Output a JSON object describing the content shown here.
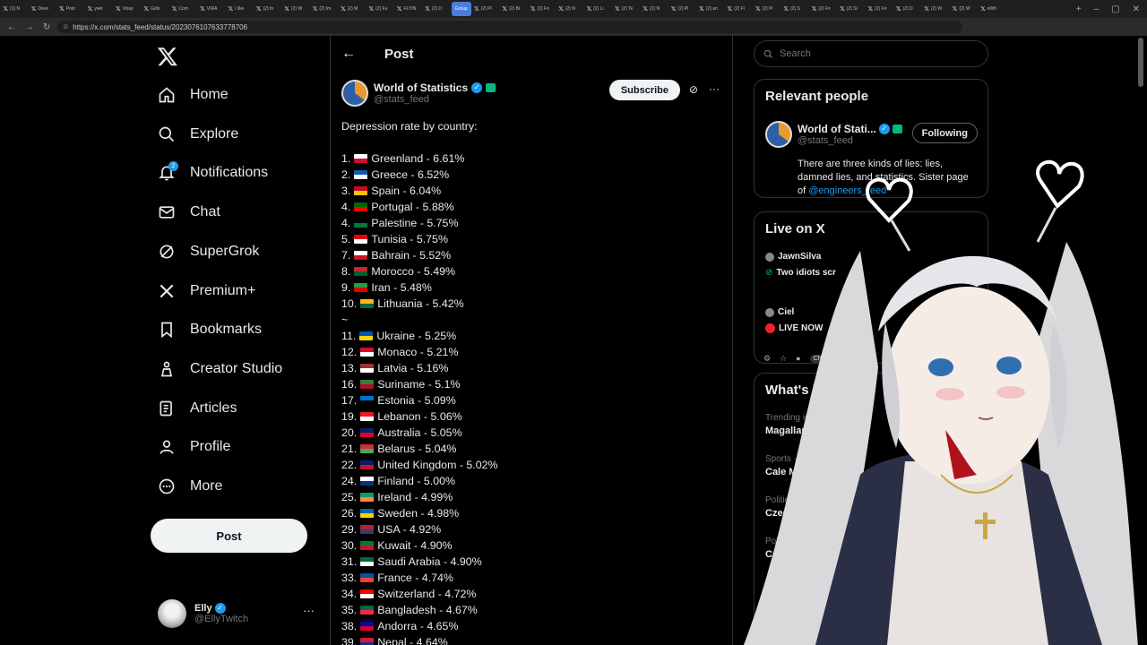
{
  "browser": {
    "tabs": [
      "(1) N",
      "Deve",
      "Post",
      "yeet",
      "Visay",
      "Grilo",
      "Com",
      "VIRA",
      "I like",
      "(2) fo",
      "(2) W",
      "(2) Im",
      "(2) M",
      "(2) Fu",
      "FLYIN",
      "(2) D",
      "Group",
      "(2) Pl",
      "(2) Bi",
      "(2) Fo",
      "(2) N",
      "(2) Li",
      "(2) Te",
      "(2) N",
      "(2) Pl",
      "(2) an",
      "(2) Fi",
      "(2) Pi",
      "(2) S",
      "(2) Fo",
      "(2) Sl",
      "(2) Fo",
      "(2) D",
      "(2) W",
      "(2) W",
      "eWh"
    ],
    "url": "https://x.com/stats_feed/status/2023076107633778706",
    "chat_label": "Chat"
  },
  "nav": {
    "items": [
      {
        "label": "Home",
        "icon": "home-icon"
      },
      {
        "label": "Explore",
        "icon": "search-icon"
      },
      {
        "label": "Notifications",
        "icon": "bell-icon"
      },
      {
        "label": "Chat",
        "icon": "mail-icon"
      },
      {
        "label": "SuperGrok",
        "icon": "grok-icon"
      },
      {
        "label": "Premium+",
        "icon": "x-icon"
      },
      {
        "label": "Bookmarks",
        "icon": "bookmark-icon"
      },
      {
        "label": "Creator Studio",
        "icon": "creator-icon"
      },
      {
        "label": "Articles",
        "icon": "article-icon"
      },
      {
        "label": "Profile",
        "icon": "person-icon"
      },
      {
        "label": "More",
        "icon": "more-circle-icon"
      }
    ],
    "notifications_count": "2",
    "post_label": "Post"
  },
  "account": {
    "name": "Elly",
    "handle": "@EllyTwitch"
  },
  "post": {
    "header": "Post",
    "author_name": "World of Statistics",
    "author_handle": "@stats_feed",
    "subscribe_label": "Subscribe",
    "intro": "Depression rate by country:",
    "tilde": "~",
    "rankings": [
      {
        "text": "1. ",
        "country": "Greenland - 6.61%",
        "flag": [
          "#ffffff",
          "#c8102e"
        ]
      },
      {
        "text": "2. ",
        "country": "Greece - 6.52%",
        "flag": [
          "#0d5eaf",
          "#ffffff"
        ]
      },
      {
        "text": "3. ",
        "country": "Spain - 6.04%",
        "flag": [
          "#c60b1e",
          "#ffc400"
        ]
      },
      {
        "text": "4. ",
        "country": "Portugal - 5.88%",
        "flag": [
          "#006600",
          "#ff0000"
        ]
      },
      {
        "text": "4. ",
        "country": "Palestine - 5.75%",
        "flag": [
          "#000000",
          "#007a3d"
        ]
      },
      {
        "text": "5. ",
        "country": "Tunisia - 5.75%",
        "flag": [
          "#e70013",
          "#ffffff"
        ]
      },
      {
        "text": "7. ",
        "country": "Bahrain - 5.52%",
        "flag": [
          "#ffffff",
          "#ce1126"
        ]
      },
      {
        "text": "8. ",
        "country": "Morocco - 5.49%",
        "flag": [
          "#c1272d",
          "#006233"
        ]
      },
      {
        "text": "9. ",
        "country": "Iran - 5.48%",
        "flag": [
          "#239f40",
          "#da0000"
        ]
      },
      {
        "text": "10. ",
        "country": "Lithuania - 5.42%",
        "flag": [
          "#fdb913",
          "#006a44"
        ]
      },
      {
        "text": "11. ",
        "country": "Ukraine - 5.25%",
        "flag": [
          "#0057b7",
          "#ffd700"
        ]
      },
      {
        "text": "12. ",
        "country": "Monaco - 5.21%",
        "flag": [
          "#ce1126",
          "#ffffff"
        ]
      },
      {
        "text": "13. ",
        "country": "Latvia - 5.16%",
        "flag": [
          "#9e3039",
          "#ffffff"
        ]
      },
      {
        "text": "16. ",
        "country": "Suriname - 5.1%",
        "flag": [
          "#377e3f",
          "#b40a2d"
        ]
      },
      {
        "text": "17. ",
        "country": "Estonia - 5.09%",
        "flag": [
          "#0072ce",
          "#000000"
        ]
      },
      {
        "text": "19. ",
        "country": "Lebanon - 5.06%",
        "flag": [
          "#ee161f",
          "#ffffff"
        ]
      },
      {
        "text": "20. ",
        "country": "Australia - 5.05%",
        "flag": [
          "#012169",
          "#e4002b"
        ]
      },
      {
        "text": "21. ",
        "country": "Belarus - 5.04%",
        "flag": [
          "#c8313e",
          "#4aa657"
        ]
      },
      {
        "text": "22. ",
        "country": "United Kingdom - 5.02%",
        "flag": [
          "#012169",
          "#c8102e"
        ]
      },
      {
        "text": "24. ",
        "country": "Finland - 5.00%",
        "flag": [
          "#ffffff",
          "#003580"
        ]
      },
      {
        "text": "25. ",
        "country": "Ireland - 4.99%",
        "flag": [
          "#169b62",
          "#ff883e"
        ]
      },
      {
        "text": "26. ",
        "country": "Sweden - 4.98%",
        "flag": [
          "#006aa7",
          "#fecc00"
        ]
      },
      {
        "text": "29. ",
        "country": "USA - 4.92%",
        "flag": [
          "#b22234",
          "#3c3b6e"
        ]
      },
      {
        "text": "30. ",
        "country": "Kuwait - 4.90%",
        "flag": [
          "#007a3d",
          "#ce1126"
        ]
      },
      {
        "text": "31. ",
        "country": "Saudi Arabia - 4.90%",
        "flag": [
          "#006c35",
          "#ffffff"
        ]
      },
      {
        "text": "33. ",
        "country": "France - 4.74%",
        "flag": [
          "#0055a4",
          "#ef4135"
        ]
      },
      {
        "text": "34. ",
        "country": "Switzerland - 4.72%",
        "flag": [
          "#ff0000",
          "#ffffff"
        ]
      },
      {
        "text": "35. ",
        "country": "Bangladesh - 4.67%",
        "flag": [
          "#006a4e",
          "#f42a41"
        ]
      },
      {
        "text": "38. ",
        "country": "Andorra - 4.65%",
        "flag": [
          "#10069f",
          "#d50032"
        ]
      },
      {
        "text": "39. ",
        "country": "Nepal - 4.64%",
        "flag": [
          "#dc143c",
          "#003893"
        ]
      }
    ]
  },
  "sidebar": {
    "search_placeholder": "Search",
    "relevant_title": "Relevant people",
    "rp_name": "World of Stati...",
    "rp_handle": "@stats_feed",
    "following_label": "Following",
    "rp_bio": "There are three kinds of lies: lies, damned lies, and statistics. Sister page of ",
    "rp_bio_link": "@engineers_feed",
    "live_title": "Live on X",
    "live_1_name": "JawnSilva",
    "live_1_title": "Two idiots scr",
    "live_2_name": "Ciel",
    "live_2_title": "LIVE NOW",
    "happening_title": "What's ha",
    "trends": [
      {
        "context": "Trending in U",
        "title": "Magallane"
      },
      {
        "context": "Sports · Tre",
        "title": "Cale Mak"
      },
      {
        "context": "Politics",
        "title": "Czech"
      },
      {
        "context": "Politi",
        "title": "Cat"
      }
    ]
  },
  "colors": {
    "accent": "#1d9bf0",
    "background": "#000000",
    "border": "#2f3336",
    "verified_green": "#00ba7c"
  }
}
